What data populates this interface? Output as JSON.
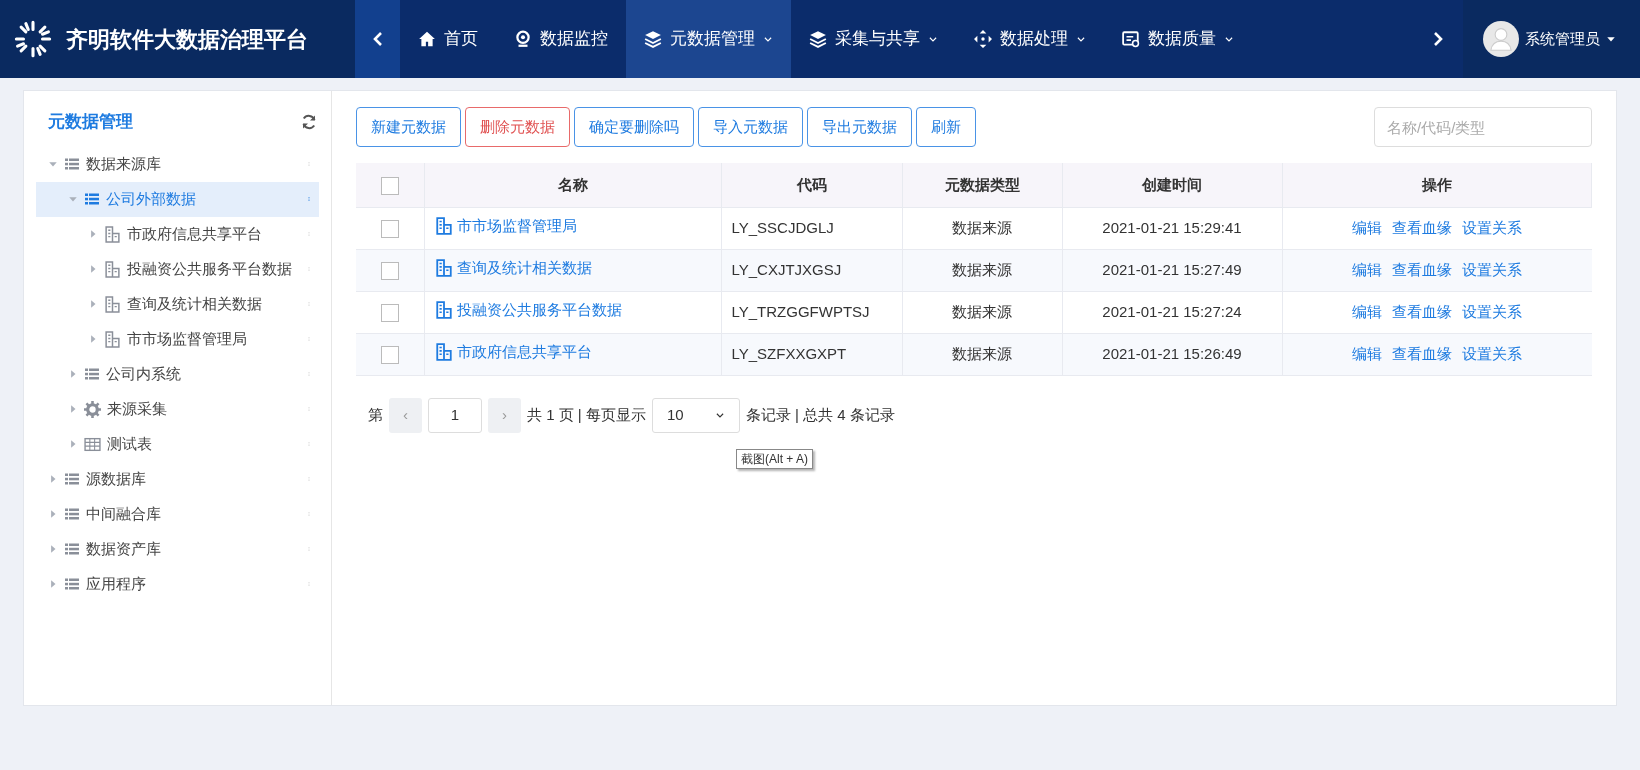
{
  "header": {
    "title": "齐明软件大数据治理平台",
    "nav": [
      {
        "kind": "home",
        "label": "首页",
        "dropdown": false,
        "selected": false
      },
      {
        "kind": "pin",
        "label": "数据监控",
        "dropdown": false,
        "selected": false
      },
      {
        "kind": "layers",
        "label": "元数据管理",
        "dropdown": true,
        "selected": true
      },
      {
        "kind": "layers",
        "label": "采集与共享",
        "dropdown": true,
        "selected": false
      },
      {
        "kind": "arrows",
        "label": "数据处理",
        "dropdown": true,
        "selected": false
      },
      {
        "kind": "quality",
        "label": "数据质量",
        "dropdown": true,
        "selected": false
      }
    ],
    "user": "系统管理员"
  },
  "sidebar": {
    "title": "元数据管理",
    "tree": [
      {
        "label": "数据来源库",
        "kind": "list",
        "expanded": true,
        "selected": false,
        "children": [
          {
            "label": "公司外部数据",
            "kind": "list",
            "expanded": true,
            "selected": true,
            "children": [
              {
                "label": "市政府信息共享平台",
                "kind": "building",
                "expanded": false,
                "selected": false
              },
              {
                "label": "投融资公共服务平台数据",
                "kind": "building",
                "expanded": false,
                "selected": false
              },
              {
                "label": "查询及统计相关数据",
                "kind": "building",
                "expanded": false,
                "selected": false
              },
              {
                "label": "市市场监督管理局",
                "kind": "building",
                "expanded": false,
                "selected": false
              }
            ]
          },
          {
            "label": "公司内系统",
            "kind": "list",
            "expanded": false,
            "selected": false
          },
          {
            "label": "来源采集",
            "kind": "gear",
            "expanded": false,
            "selected": false
          },
          {
            "label": "测试表",
            "kind": "table",
            "expanded": false,
            "selected": false
          }
        ]
      },
      {
        "label": "源数据库",
        "kind": "list",
        "expanded": false,
        "selected": false
      },
      {
        "label": "中间融合库",
        "kind": "list",
        "expanded": false,
        "selected": false
      },
      {
        "label": "数据资产库",
        "kind": "list",
        "expanded": false,
        "selected": false
      },
      {
        "label": "应用程序",
        "kind": "list",
        "expanded": false,
        "selected": false
      }
    ]
  },
  "toolbar": {
    "buttons": [
      {
        "label": "新建元数据",
        "kind": "normal"
      },
      {
        "label": "删除元数据",
        "kind": "danger"
      },
      {
        "label": "确定要删除吗",
        "kind": "normal"
      },
      {
        "label": "导入元数据",
        "kind": "normal"
      },
      {
        "label": "导出元数据",
        "kind": "normal"
      },
      {
        "label": "刷新",
        "kind": "normal"
      }
    ],
    "search": {
      "placeholder": "名称/代码/类型"
    }
  },
  "table": {
    "all_checked": false,
    "columns": [
      "名称",
      "代码",
      "元数据类型",
      "创建时间",
      "操作"
    ],
    "rows": [
      {
        "checked": false,
        "name": "市市场监督管理局",
        "code": "LY_SSCJDGLJ",
        "type": "数据来源",
        "created": "2021-01-21 15:29:41",
        "actions": [
          "编辑",
          "查看血缘",
          "设置关系"
        ]
      },
      {
        "checked": false,
        "name": "查询及统计相关数据",
        "code": "LY_CXJTJXGSJ",
        "type": "数据来源",
        "created": "2021-01-21 15:27:49",
        "actions": [
          "编辑",
          "查看血缘",
          "设置关系"
        ]
      },
      {
        "checked": false,
        "name": "投融资公共服务平台数据",
        "code": "LY_TRZGGFWPTSJ",
        "type": "数据来源",
        "created": "2021-01-21 15:27:24",
        "actions": [
          "编辑",
          "查看血缘",
          "设置关系"
        ]
      },
      {
        "checked": false,
        "name": "市政府信息共享平台",
        "code": "LY_SZFXXGXPT",
        "type": "数据来源",
        "created": "2021-01-21 15:26:49",
        "actions": [
          "编辑",
          "查看血缘",
          "设置关系"
        ]
      }
    ]
  },
  "pagination": {
    "prefix": "第",
    "prev": "‹",
    "page": "1",
    "next": "›",
    "pages_text": "共 1 页 | 每页显示",
    "page_size": "10",
    "suffix": "条记录 | 总共 4 条记录"
  },
  "tooltip": "截图(Alt + A)"
}
